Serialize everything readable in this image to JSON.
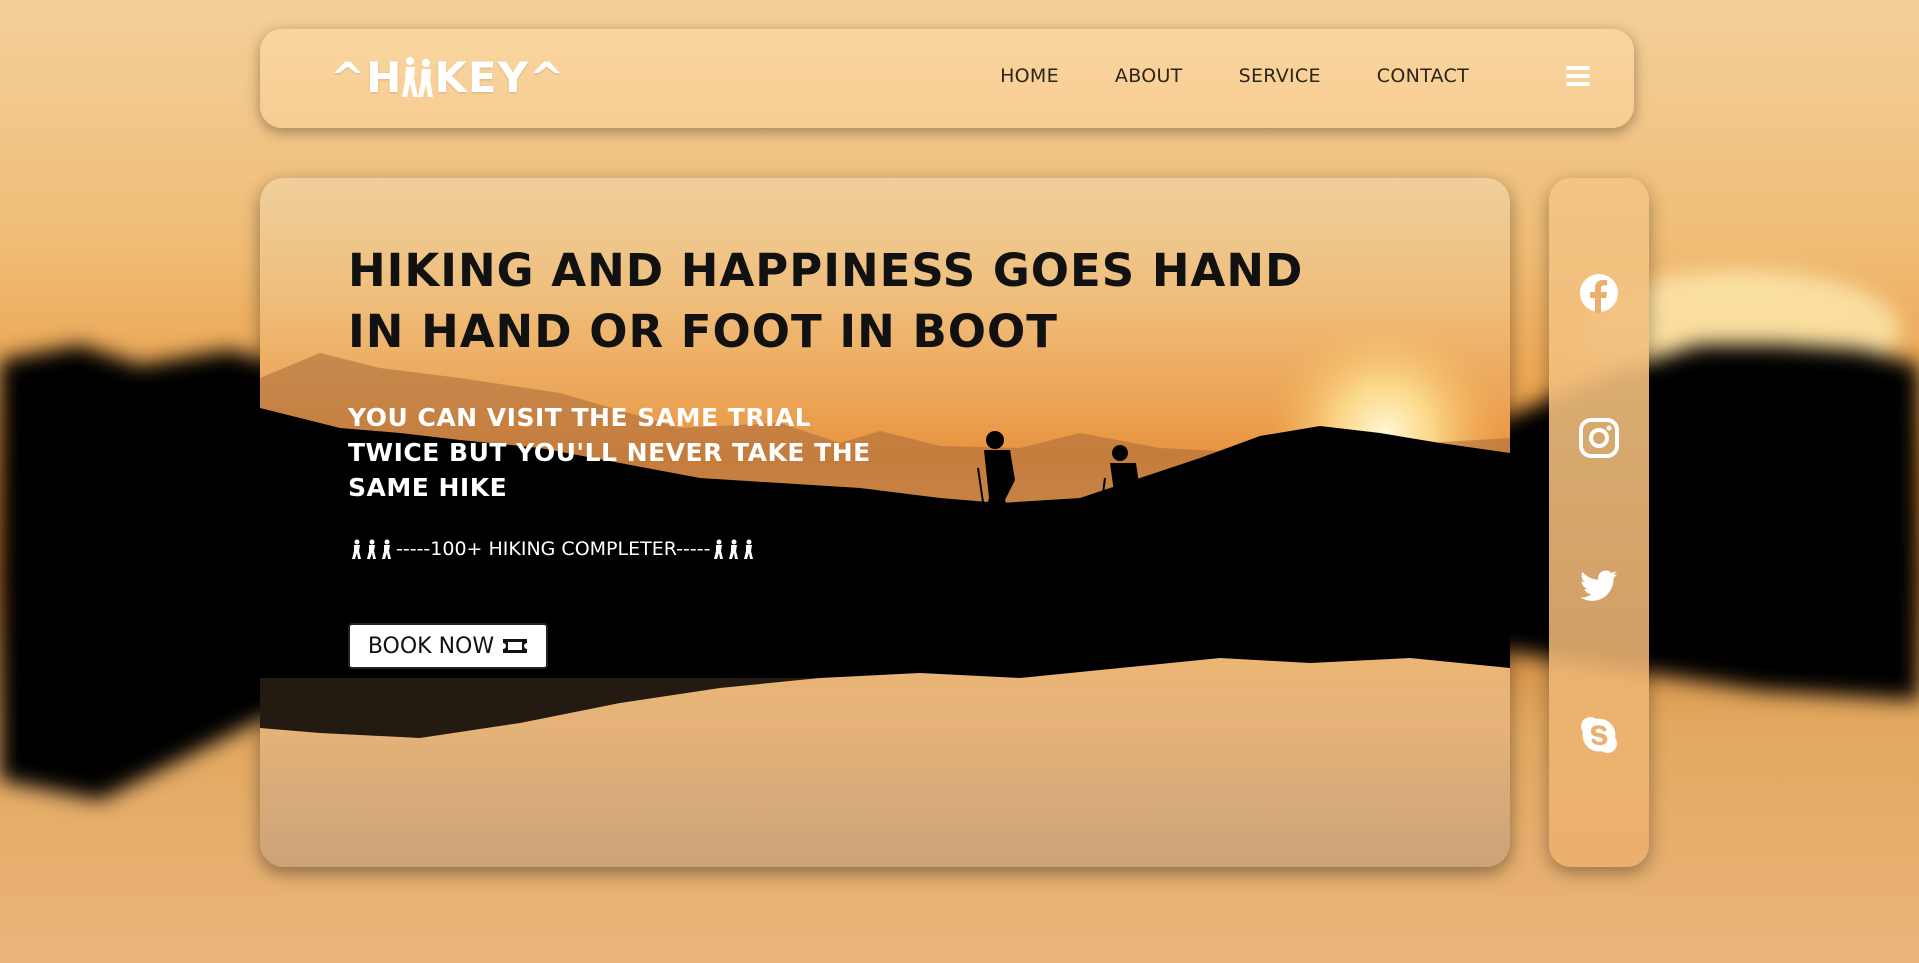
{
  "logo": {
    "before": "^H",
    "after": "KEY^"
  },
  "nav": {
    "items": [
      {
        "label": "HOME"
      },
      {
        "label": "ABOUT"
      },
      {
        "label": "SERVICE"
      },
      {
        "label": "CONTACT"
      }
    ],
    "menu_icon": "hamburger-icon"
  },
  "hero": {
    "title": "HIKING AND HAPPINESS GOES HAND IN HAND OR FOOT IN BOOT",
    "subtitle": "YOU CAN VISIT THE SAME TRIAL TWICE BUT YOU'LL NEVER TAKE THE SAME HIKE",
    "stat_text": "-----100+ HIKING COMPLETER-----",
    "button_label": "BOOK NOW"
  },
  "social": [
    {
      "name": "facebook-icon"
    },
    {
      "name": "instagram-icon"
    },
    {
      "name": "twitter-icon"
    },
    {
      "name": "skype-icon"
    }
  ],
  "colors": {
    "accent_white": "#ffffff",
    "nav_text": "#2d2418",
    "panel": "#f7cd94",
    "sunset_orange": "#e89440"
  }
}
